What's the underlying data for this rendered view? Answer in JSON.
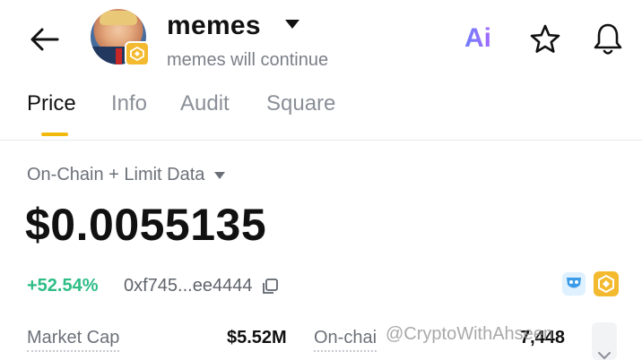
{
  "header": {
    "token_name": "memes",
    "subtitle": "memes will continue",
    "ai_label": "Ai"
  },
  "tabs": [
    {
      "label": "Price",
      "active": true
    },
    {
      "label": "Info",
      "active": false
    },
    {
      "label": "Audit",
      "active": false
    },
    {
      "label": "Square",
      "active": false
    }
  ],
  "price_panel": {
    "data_source": "On-Chain + Limit Data",
    "price": "$0.0055135",
    "change": "+52.54%",
    "contract_address": "0xf745...ee4444"
  },
  "stats": {
    "market_cap_label": "Market Cap",
    "market_cap_value": "$5.52M",
    "onchain_label": "On-chai",
    "onchain_value": "7,448"
  },
  "watermark": "@CryptoWithAhseen",
  "colors": {
    "accent": "#f0b90b",
    "positive": "#2ebd85",
    "bnb": "#f3ba2f",
    "ai_gradient_start": "#6d7dff",
    "ai_gradient_end": "#a56bff"
  },
  "icons": {
    "back": "arrow-left-icon",
    "dropdown": "caret-down-icon",
    "favorite": "star-icon",
    "notifications": "bell-icon",
    "copy": "copy-icon",
    "chain_badge": "bnb-chain-icon",
    "security": "mask-icon",
    "expand": "chevron-down-icon"
  }
}
